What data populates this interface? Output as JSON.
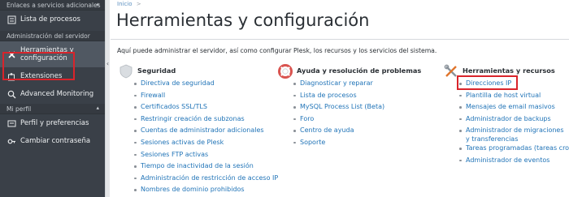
{
  "sidebar": {
    "sections": [
      {
        "label": "Enlaces a servicios adicionales"
      },
      {
        "label": "Administración del servidor"
      },
      {
        "label": "Mi perfil"
      }
    ],
    "items": [
      {
        "label": "Lista de procesos",
        "icon": "list-icon"
      },
      {
        "label": "Herramientas y configuración",
        "label_line1": "Herramientas y",
        "label_line2": "configuración",
        "icon": "tools-icon",
        "active": true
      },
      {
        "label": "Extensiones",
        "icon": "puzzle-icon"
      },
      {
        "label": "Advanced Monitoring",
        "icon": "magnifier-icon"
      },
      {
        "label": "Perfil y preferencias",
        "icon": "profile-icon"
      },
      {
        "label": "Cambiar contraseña",
        "icon": "key-icon"
      }
    ],
    "collapse_glyph": "‹"
  },
  "breadcrumb": {
    "home": "Inicio",
    "separator": ">"
  },
  "page": {
    "title": "Herramientas y configuración",
    "intro": "Aquí puede administrar el servidor, así como configurar Plesk, los recursos y los servicios del sistema."
  },
  "columns": [
    {
      "heading": "Seguridad",
      "icon": "shield-icon",
      "links": [
        "Directiva de seguridad",
        "Firewall",
        "Certificados SSL/TLS",
        "Restringir creación de subzonas",
        "Cuentas de administrador adicionales",
        "Sesiones activas de Plesk",
        "Sesiones FTP activas",
        "Tiempo de inactividad de la sesión",
        "Administración de restricción de acceso IP",
        "Nombres de dominio prohibidos"
      ]
    },
    {
      "heading": "Ayuda y resolución de problemas",
      "icon": "lifebuoy-icon",
      "links": [
        "Diagnosticar y reparar",
        "Lista de procesos",
        "MySQL Process List (Beta)",
        "Foro",
        "Centro de ayuda",
        "Soporte"
      ]
    },
    {
      "heading": "Herramientas y recursos",
      "icon": "tools-icon",
      "links": [
        "Direcciones IP",
        "Plantilla de host virtual",
        "Mensajes de email masivos",
        "Administrador de backups",
        "Administrador de migraciones y transferencias",
        "Tareas programadas (tareas cron)",
        "Administrador de eventos"
      ]
    }
  ],
  "colors": {
    "sidebar_bg": "#3a4048",
    "link": "#1f73b7",
    "highlight": "#d9242b"
  }
}
